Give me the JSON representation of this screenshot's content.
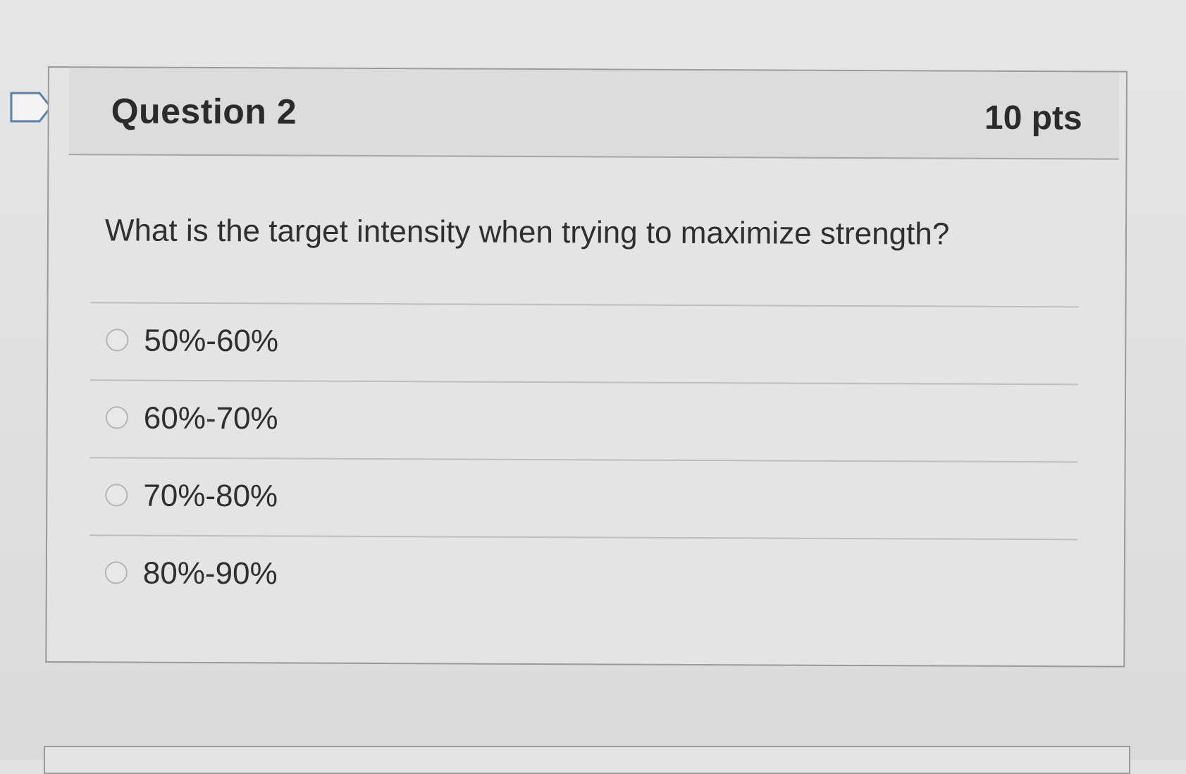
{
  "question": {
    "title": "Question 2",
    "points": "10 pts",
    "prompt": "What is the target intensity when trying to maximize strength?",
    "answers": [
      {
        "label": "50%-60%"
      },
      {
        "label": "60%-70%"
      },
      {
        "label": "70%-80%"
      },
      {
        "label": "80%-90%"
      }
    ]
  },
  "icons": {
    "flag": "flag-icon",
    "radio": "radio-button"
  },
  "colors": {
    "background": "#e2e2e2",
    "text": "#2f2f2f",
    "border": "#9a9a9a",
    "header": "#dcdcdc"
  }
}
